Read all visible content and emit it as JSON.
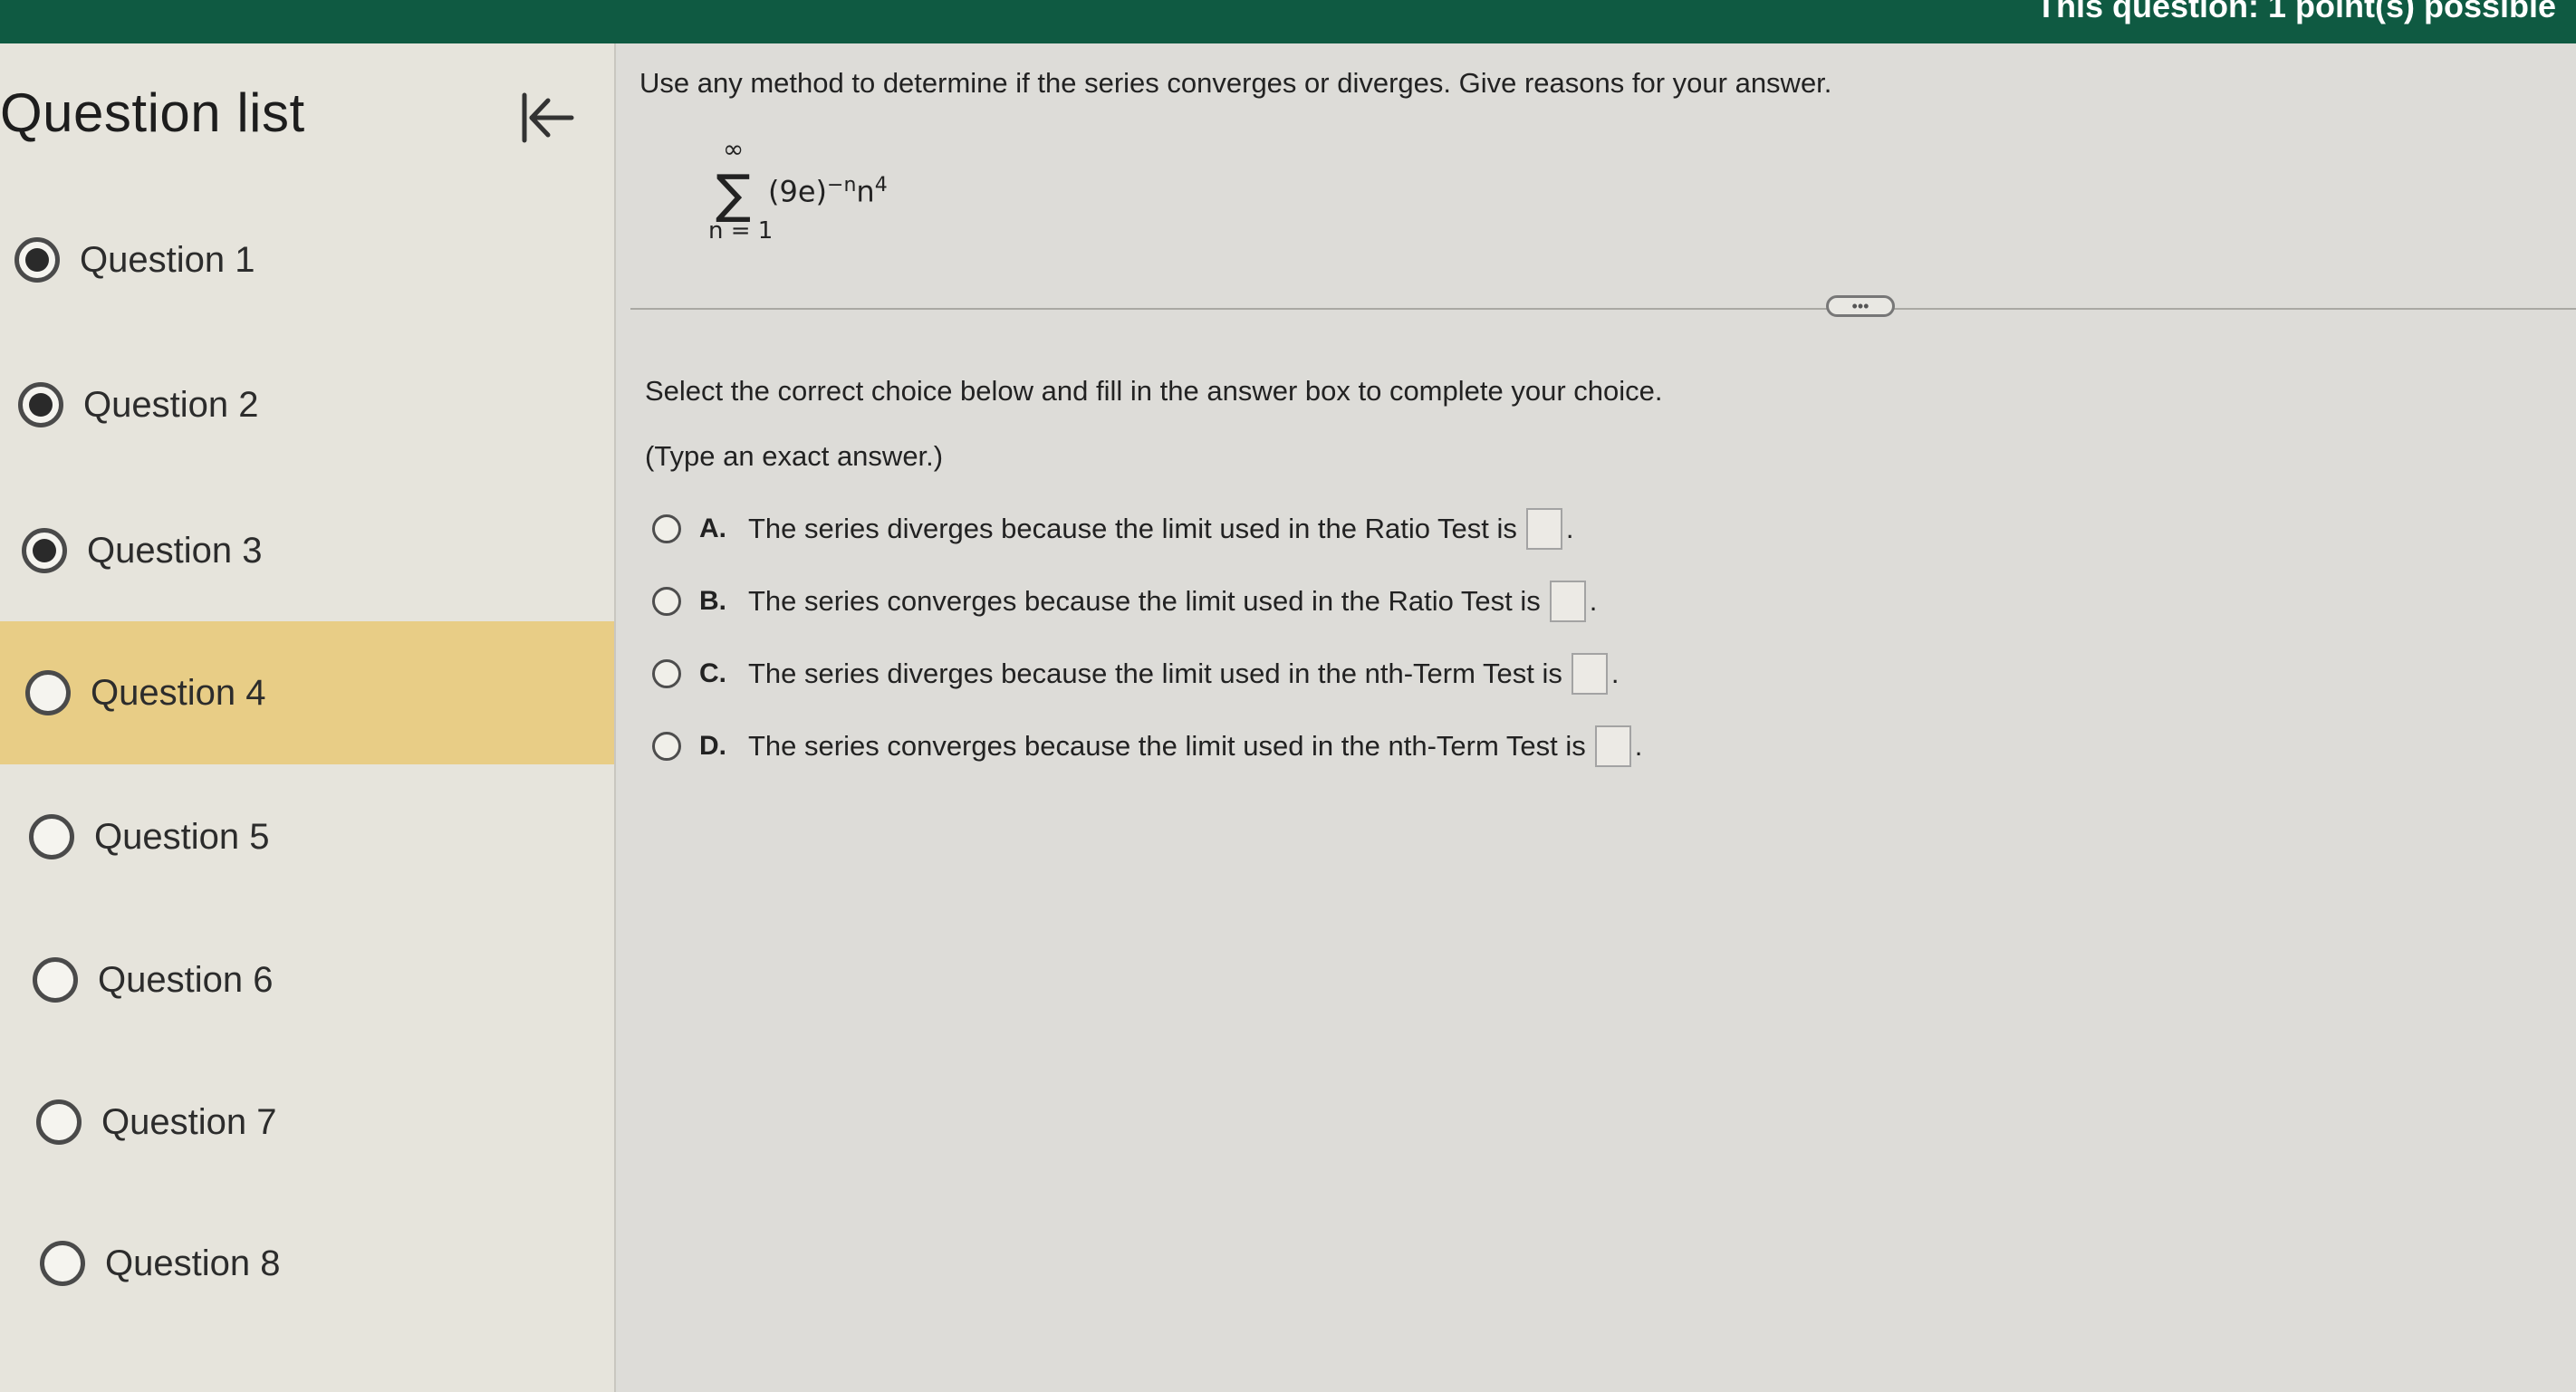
{
  "header": {
    "points_text": "This question: 1 point(s) possible"
  },
  "sidebar": {
    "title": "Question list",
    "items": [
      {
        "label": "Question 1",
        "status": "answered"
      },
      {
        "label": "Question 2",
        "status": "answered"
      },
      {
        "label": "Question 3",
        "status": "answered"
      },
      {
        "label": "Question 4",
        "status": "current"
      },
      {
        "label": "Question 5",
        "status": "unanswered"
      },
      {
        "label": "Question 6",
        "status": "unanswered"
      },
      {
        "label": "Question 7",
        "status": "unanswered"
      },
      {
        "label": "Question 8",
        "status": "unanswered"
      }
    ]
  },
  "question": {
    "prompt": "Use any method to determine if the series converges or diverges. Give reasons for your answer.",
    "series": {
      "upper": "∞",
      "lower": "n = 1",
      "base": "(9e)",
      "exponent": "−n",
      "factor": "n",
      "factor_exponent": "4"
    },
    "more_label": "•••",
    "instruction": "Select the correct choice below and fill in the answer box to complete your choice.",
    "note": "(Type an exact answer.)",
    "choices": [
      {
        "letter": "A.",
        "text": "The series diverges because the limit used in the Ratio Test is"
      },
      {
        "letter": "B.",
        "text": "The series converges because the limit used in the Ratio Test is"
      },
      {
        "letter": "C.",
        "text": "The series diverges because the limit used in the nth-Term Test is"
      },
      {
        "letter": "D.",
        "text": "The series converges because the limit used in the nth-Term Test is"
      }
    ]
  },
  "colors": {
    "header": "#0f5a42",
    "selected_item": "#e8cd86"
  },
  "icons": {
    "collapse": "collapse-left-arrow-icon"
  }
}
